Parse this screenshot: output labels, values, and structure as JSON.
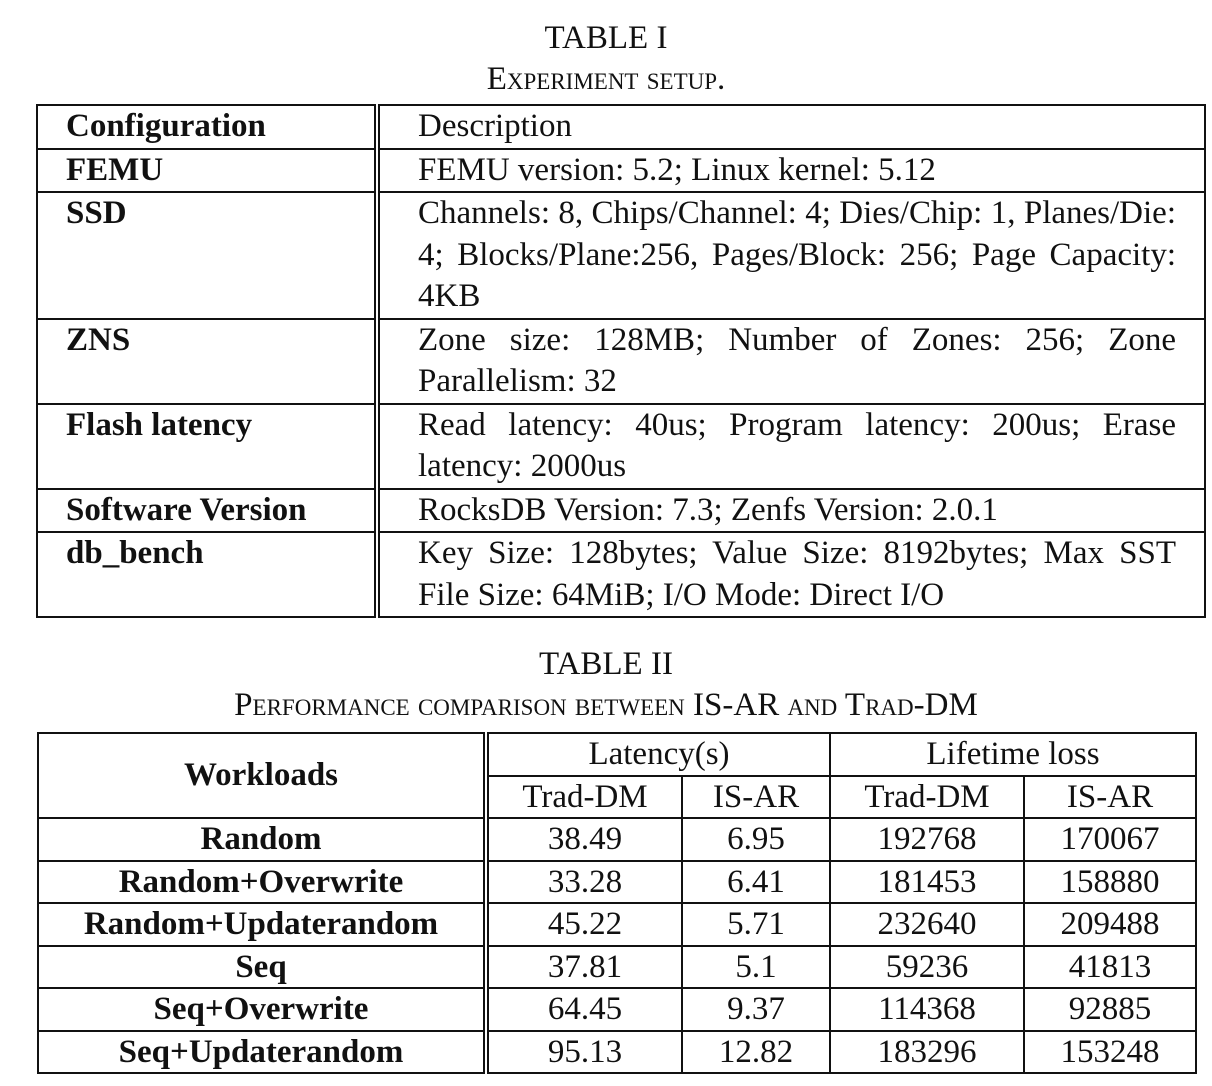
{
  "table1": {
    "number": "TABLE I",
    "title": "Experiment setup.",
    "header": [
      "Configuration",
      "Description"
    ],
    "rows": [
      {
        "config": "FEMU",
        "description": "FEMU version: 5.2; Linux kernel: 5.12"
      },
      {
        "config": "SSD",
        "description": "Channels: 8, Chips/Channel: 4; Dies/Chip: 1, Planes/Die: 4; Blocks/Plane:256, Pages/Block: 256; Page Capacity: 4KB"
      },
      {
        "config": "ZNS",
        "description": "Zone size: 128MB; Number of Zones: 256; Zone Parallelism: 32"
      },
      {
        "config": "Flash latency",
        "description": "Read latency: 40us; Program latency: 200us; Erase latency: 2000us"
      },
      {
        "config": "Software Version",
        "description": "RocksDB Version: 7.3; Zenfs Version: 2.0.1"
      },
      {
        "config": "db_bench",
        "description": "Key Size: 128bytes; Value Size: 8192bytes; Max SST File Size: 64MiB; I/O Mode: Direct I/O"
      }
    ]
  },
  "table2": {
    "number": "TABLE II",
    "title": "Performance comparison between IS-AR and Trad-DM",
    "header": {
      "workloads": "Workloads",
      "latency": "Latency(s)",
      "lifetime": "Lifetime loss",
      "trad": "Trad-DM",
      "isar": "IS-AR"
    },
    "rows": [
      {
        "workload": "Random",
        "lat_trad": "38.49",
        "lat_isar": "6.95",
        "life_trad": "192768",
        "life_isar": "170067"
      },
      {
        "workload": "Random+Overwrite",
        "lat_trad": "33.28",
        "lat_isar": "6.41",
        "life_trad": "181453",
        "life_isar": "158880"
      },
      {
        "workload": "Random+Updaterandom",
        "lat_trad": "45.22",
        "lat_isar": "5.71",
        "life_trad": "232640",
        "life_isar": "209488"
      },
      {
        "workload": "Seq",
        "lat_trad": "37.81",
        "lat_isar": "5.1",
        "life_trad": "59236",
        "life_isar": "41813"
      },
      {
        "workload": "Seq+Overwrite",
        "lat_trad": "64.45",
        "lat_isar": "9.37",
        "life_trad": "114368",
        "life_isar": "92885"
      },
      {
        "workload": "Seq+Updaterandom",
        "lat_trad": "95.13",
        "lat_isar": "12.82",
        "life_trad": "183296",
        "life_isar": "153248"
      }
    ]
  }
}
